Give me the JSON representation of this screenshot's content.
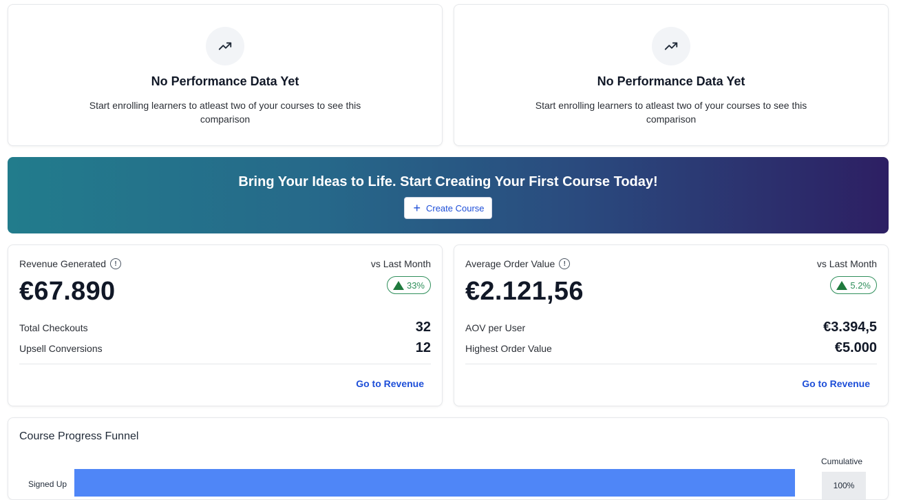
{
  "empty_states": [
    {
      "icon": "trending-up-icon",
      "title": "No Performance Data Yet",
      "description": "Start enrolling learners to atleast two of your courses to see this comparison"
    },
    {
      "icon": "trending-up-icon",
      "title": "No Performance Data Yet",
      "description": "Start enrolling learners to atleast two of your courses to see this comparison"
    }
  ],
  "banner": {
    "headline": "Bring Your Ideas to Life. Start Creating Your First Course Today!",
    "button_label": "Create Course",
    "gradient_start": "#227c8c",
    "gradient_end": "#2d1f63"
  },
  "revenue": {
    "label": "Revenue Generated",
    "comparison": "vs Last Month",
    "value": "€67.890",
    "delta": "33%",
    "rows": [
      {
        "label": "Total Checkouts",
        "value": "32"
      },
      {
        "label": "Upsell Conversions",
        "value": "12"
      }
    ],
    "link": "Go to Revenue"
  },
  "aov": {
    "label": "Average Order Value",
    "comparison": "vs Last Month",
    "value": "€2.121,56",
    "delta": "5.2%",
    "rows": [
      {
        "label": "AOV per User",
        "value": "€3.394,5"
      },
      {
        "label": "Highest Order Value",
        "value": "€5.000"
      }
    ],
    "link": "Go to Revenue"
  },
  "funnel": {
    "title": "Course Progress Funnel",
    "cumulative_label": "Cumulative",
    "stages": [
      {
        "label": "Signed Up",
        "cumulative": "100%"
      }
    ],
    "bar_color": "#4f86f7"
  },
  "colors": {
    "accent": "#1d4ed8",
    "positive": "#2f8f5b"
  }
}
